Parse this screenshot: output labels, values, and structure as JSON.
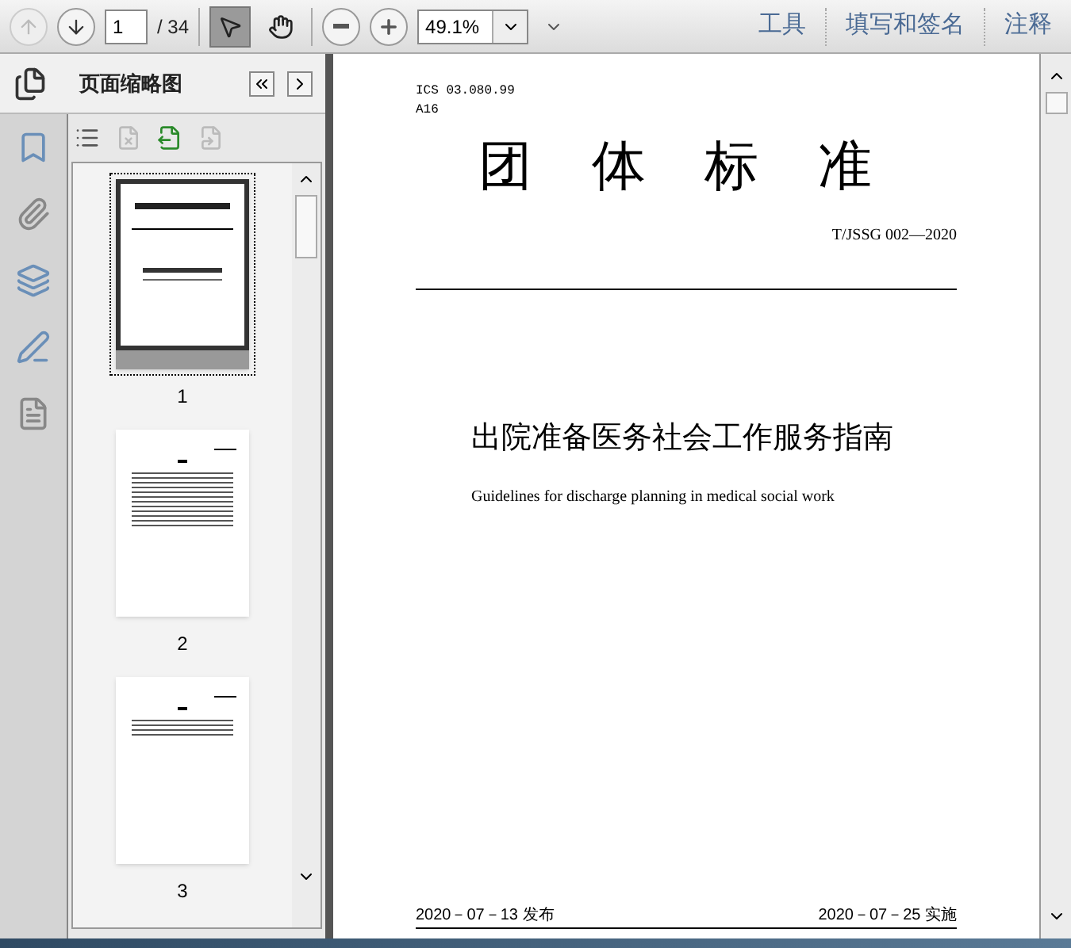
{
  "toolbar": {
    "page_input": "1",
    "page_total": "/ 34",
    "tools": [
      {
        "kind": "select",
        "selected": true
      },
      {
        "kind": "hand",
        "selected": false
      }
    ],
    "zoom": "49.1%",
    "links": [
      "工具",
      "填写和签名",
      "注释"
    ]
  },
  "thumbnails_panel": {
    "title": "页面缩略图",
    "thumbnails": [
      {
        "page": "1",
        "kind": "cover",
        "selected": true
      },
      {
        "page": "2",
        "kind": "contents",
        "selected": false
      },
      {
        "page": "3",
        "kind": "text",
        "selected": false
      }
    ]
  },
  "document": {
    "ics": "ICS 03.080.99",
    "class_code": "A16",
    "heading": "团 体 标 准",
    "standard_number": "T/JSSG 002—2020",
    "title": "出院准备医务社会工作服务指南",
    "subtitle": "Guidelines for discharge planning in medical social work",
    "publish_date": "2020－07－13 发布",
    "effective_date": "2020－07－25 实施"
  }
}
